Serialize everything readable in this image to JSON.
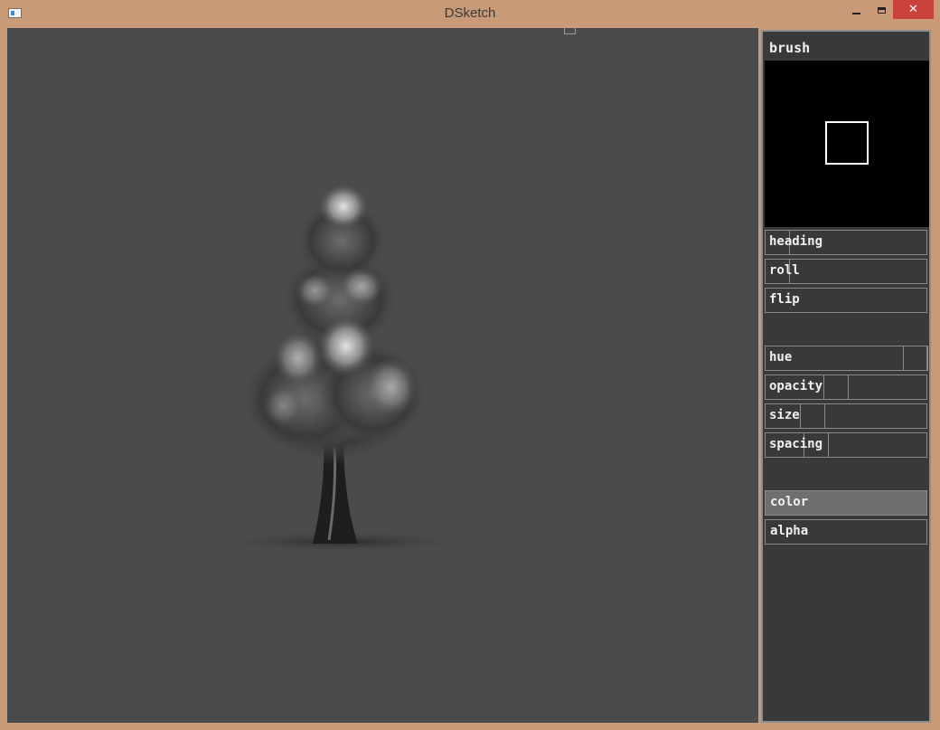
{
  "window": {
    "title": "DSketch",
    "close_glyph": "✕"
  },
  "panel": {
    "title": "brush",
    "sliders_transform": [
      {
        "label": "heading",
        "value": 0.15
      },
      {
        "label": "roll",
        "value": 0.15
      },
      {
        "label": "flip",
        "value": 0
      }
    ],
    "sliders_color": [
      {
        "label": "hue",
        "value": 0.85
      },
      {
        "label": "opacity",
        "value": 0.35
      },
      {
        "label": "size",
        "value": 0.2
      },
      {
        "label": "spacing",
        "value": 0.25
      }
    ],
    "buttons": [
      {
        "label": "color",
        "active": true
      },
      {
        "label": "alpha",
        "active": false
      }
    ]
  },
  "colors": {
    "canvas": "#4b4b4b",
    "panel": "#393939",
    "frame": "#c99a78",
    "close": "#c8413a"
  }
}
